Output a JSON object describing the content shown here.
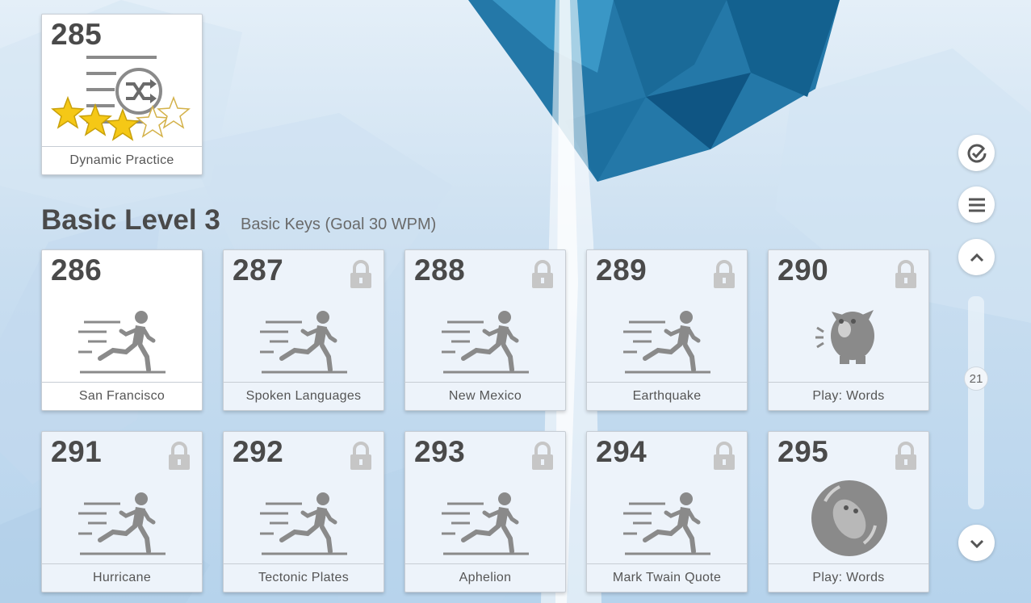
{
  "top_lesson": {
    "number": "285",
    "title": "Dynamic Practice",
    "stars_earned": 3,
    "stars_total": 5
  },
  "section": {
    "title": "Basic Level 3",
    "subtitle": "Basic Keys (Goal 30 WPM)"
  },
  "lessons": [
    {
      "number": "286",
      "title": "San Francisco",
      "locked": false,
      "icon": "runner-icon"
    },
    {
      "number": "287",
      "title": "Spoken Languages",
      "locked": true,
      "icon": "runner-icon"
    },
    {
      "number": "288",
      "title": "New Mexico",
      "locked": true,
      "icon": "runner-icon"
    },
    {
      "number": "289",
      "title": "Earthquake",
      "locked": true,
      "icon": "runner-icon"
    },
    {
      "number": "290",
      "title": "Play: Words",
      "locked": true,
      "icon": "monster-game-icon"
    },
    {
      "number": "291",
      "title": "Hurricane",
      "locked": true,
      "icon": "runner-icon"
    },
    {
      "number": "292",
      "title": "Tectonic Plates",
      "locked": true,
      "icon": "runner-icon"
    },
    {
      "number": "293",
      "title": "Aphelion",
      "locked": true,
      "icon": "runner-icon"
    },
    {
      "number": "294",
      "title": "Mark Twain Quote",
      "locked": true,
      "icon": "runner-icon"
    },
    {
      "number": "295",
      "title": "Play: Words",
      "locked": true,
      "icon": "bubble-creature-game-icon"
    }
  ],
  "sidebar": {
    "buttons": [
      "check-circle-icon",
      "menu-icon",
      "chevron-up-icon",
      "chevron-down-icon"
    ],
    "scroll_position_label": "21"
  },
  "colors": {
    "text_dark": "#4a4a4a",
    "star_gold": "#f5c816",
    "lock_grey": "#c6c6c6",
    "locked_card_bg": "#edf3fa"
  }
}
